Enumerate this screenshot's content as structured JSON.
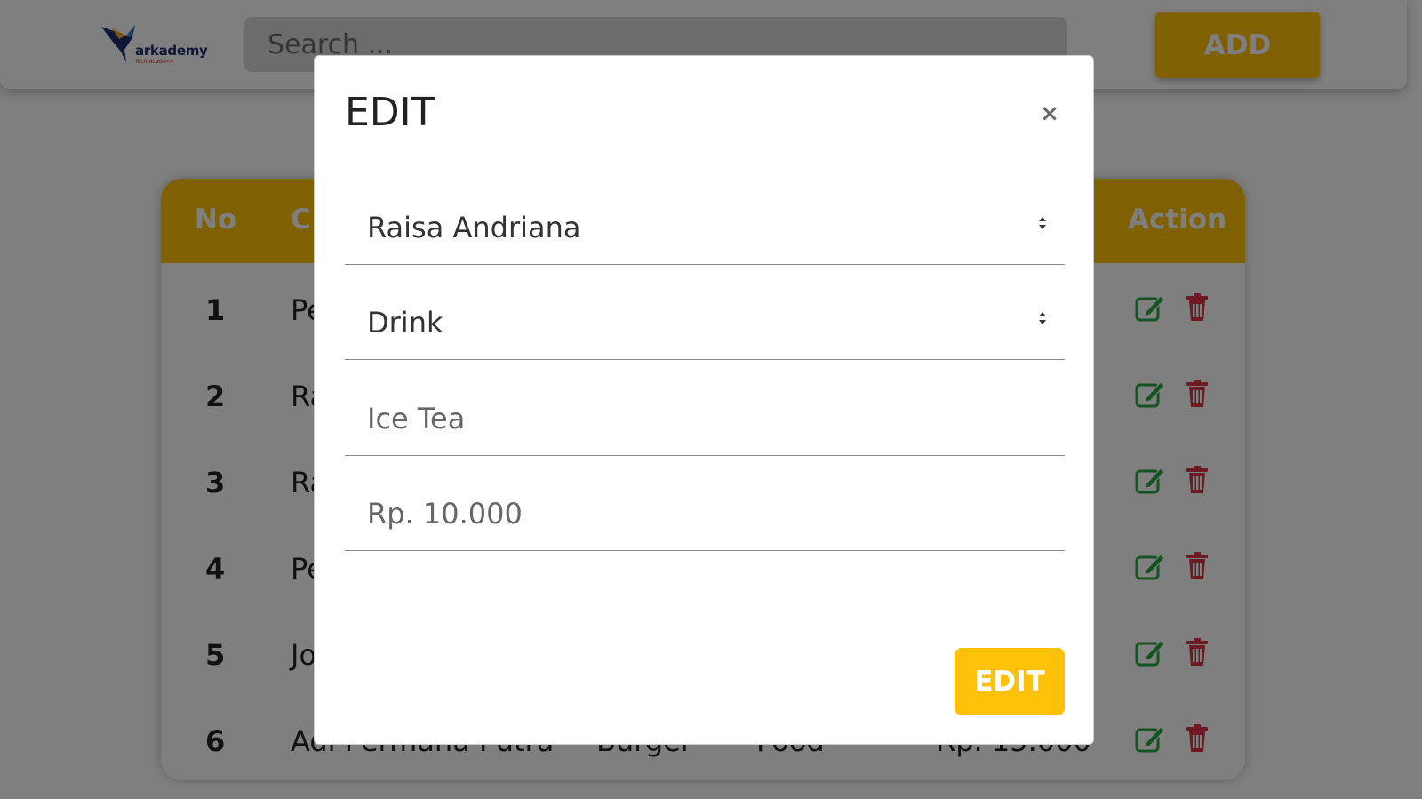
{
  "navbar": {
    "logo_text": "arkademy",
    "logo_sub": "Tech Academy",
    "search_placeholder": "Search ...",
    "add_label": "ADD"
  },
  "table": {
    "headers": {
      "no": "No",
      "cashier_partial": "C",
      "action": "Action"
    },
    "rows": [
      {
        "no": "1",
        "name": "Pe"
      },
      {
        "no": "2",
        "name": "Ra"
      },
      {
        "no": "3",
        "name": "Ra"
      },
      {
        "no": "4",
        "name": "Pe"
      },
      {
        "no": "5",
        "name": "Jo"
      },
      {
        "no": "6",
        "name": "Adi Permana Putra",
        "product": "Burger",
        "category": "Food",
        "price": "Rp. 15.000"
      }
    ]
  },
  "modal": {
    "title": "EDIT",
    "close_label": "×",
    "cashier_value": "Raisa Andriana",
    "category_value": "Drink",
    "product_placeholder": "Ice Tea",
    "price_placeholder": "Rp. 10.000",
    "submit_label": "EDIT"
  },
  "colors": {
    "accent": "#ffc107",
    "edit_icon": "#28a745",
    "delete_icon": "#dc3545"
  }
}
